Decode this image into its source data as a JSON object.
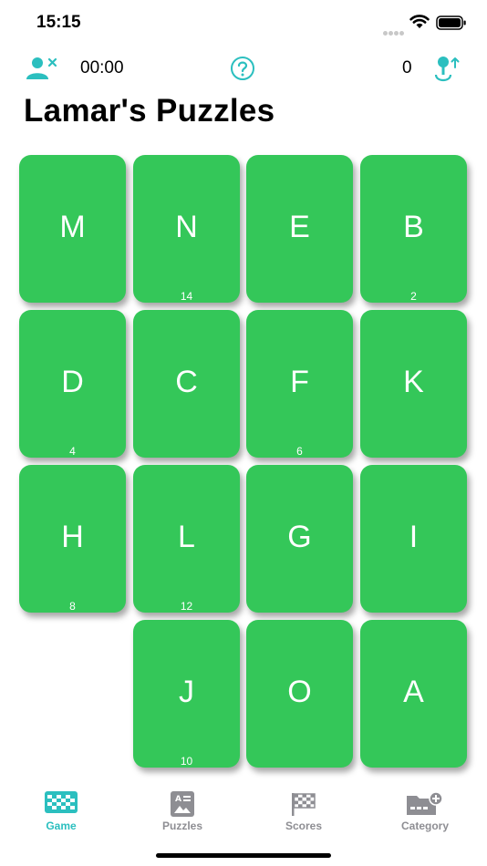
{
  "status_bar": {
    "time": "15:15"
  },
  "toolbar": {
    "timer": "00:00",
    "score": "0"
  },
  "page": {
    "title": "Lamar's Puzzles"
  },
  "tiles": [
    {
      "letter": "M",
      "count": ""
    },
    {
      "letter": "N",
      "count": "14"
    },
    {
      "letter": "E",
      "count": ""
    },
    {
      "letter": "B",
      "count": "2"
    },
    {
      "letter": "D",
      "count": "4"
    },
    {
      "letter": "C",
      "count": ""
    },
    {
      "letter": "F",
      "count": "6"
    },
    {
      "letter": "K",
      "count": ""
    },
    {
      "letter": "H",
      "count": "8"
    },
    {
      "letter": "L",
      "count": "12"
    },
    {
      "letter": "G",
      "count": ""
    },
    {
      "letter": "I",
      "count": ""
    },
    {
      "letter": "J",
      "count": "10"
    },
    {
      "letter": "O",
      "count": ""
    },
    {
      "letter": "A",
      "count": ""
    }
  ],
  "tabs": [
    {
      "label": "Game",
      "icon": "checkerboard-icon",
      "active": true
    },
    {
      "label": "Puzzles",
      "icon": "puzzle-card-icon",
      "active": false
    },
    {
      "label": "Scores",
      "icon": "checkered-flag-icon",
      "active": false
    },
    {
      "label": "Category",
      "icon": "folder-add-icon",
      "active": false
    }
  ],
  "colors": {
    "tile": "#34c759",
    "accent": "#2bbfbf",
    "tab_inactive": "#8e8e93"
  }
}
